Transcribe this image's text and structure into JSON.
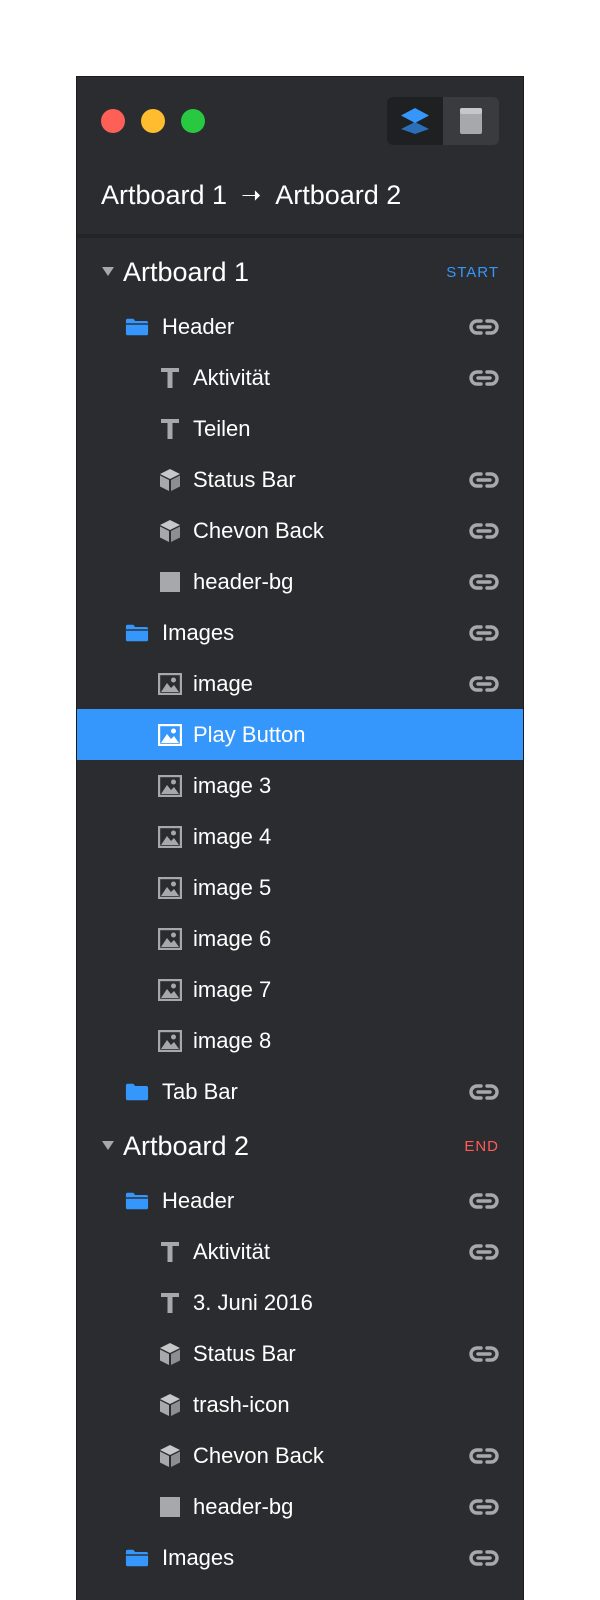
{
  "window": {
    "traffic_lights": [
      "close",
      "minimize",
      "zoom"
    ],
    "view_toggle": {
      "left_icon": "layers-icon",
      "right_icon": "artboard-icon",
      "selected": "layers"
    }
  },
  "breadcrumb": {
    "from": "Artboard 1",
    "arrow": "➝",
    "to": "Artboard 2"
  },
  "colors": {
    "accent": "#3597fb",
    "end": "#ff5a5a",
    "panel": "#2b2c2f",
    "icon_gray": "#a7a8ab"
  },
  "tree": {
    "artboard1": {
      "label": "Artboard 1",
      "badge": "START",
      "header": {
        "label": "Header",
        "linked": true,
        "children": [
          {
            "label": "Aktivität",
            "icon": "text-icon",
            "linked": true
          },
          {
            "label": "Teilen",
            "icon": "text-icon",
            "linked": false
          },
          {
            "label": "Status Bar",
            "icon": "symbol-icon",
            "linked": true
          },
          {
            "label": "Chevon Back",
            "icon": "symbol-icon",
            "linked": true
          },
          {
            "label": "header-bg",
            "icon": "rectangle-icon",
            "linked": true
          }
        ]
      },
      "images": {
        "label": "Images",
        "linked": true,
        "children": [
          {
            "label": "image",
            "icon": "image-icon",
            "linked": true
          },
          {
            "label": "Play Button",
            "icon": "image-icon",
            "linked": false,
            "selected": true
          },
          {
            "label": "image 3",
            "icon": "image-icon",
            "linked": false
          },
          {
            "label": "image 4",
            "icon": "image-icon",
            "linked": false
          },
          {
            "label": "image 5",
            "icon": "image-icon",
            "linked": false
          },
          {
            "label": "image 6",
            "icon": "image-icon",
            "linked": false
          },
          {
            "label": "image 7",
            "icon": "image-icon",
            "linked": false
          },
          {
            "label": "image 8",
            "icon": "image-icon",
            "linked": false
          }
        ]
      },
      "tabbar": {
        "label": "Tab Bar",
        "linked": true
      }
    },
    "artboard2": {
      "label": "Artboard 2",
      "badge": "END",
      "header": {
        "label": "Header",
        "linked": true,
        "children": [
          {
            "label": "Aktivität",
            "icon": "text-icon",
            "linked": true
          },
          {
            "label": "3. Juni 2016",
            "icon": "text-icon",
            "linked": false
          },
          {
            "label": "Status Bar",
            "icon": "symbol-icon",
            "linked": true
          },
          {
            "label": "trash-icon",
            "icon": "symbol-icon",
            "linked": false
          },
          {
            "label": "Chevon Back",
            "icon": "symbol-icon",
            "linked": true
          },
          {
            "label": "header-bg",
            "icon": "rectangle-icon",
            "linked": true
          }
        ]
      },
      "images": {
        "label": "Images",
        "linked": true
      }
    }
  }
}
